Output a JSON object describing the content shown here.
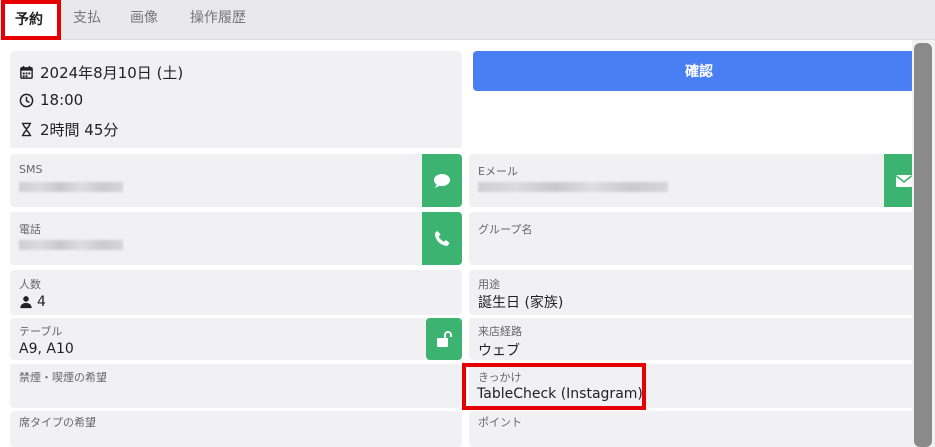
{
  "tabs": [
    {
      "label": "予約",
      "active": true
    },
    {
      "label": "支払"
    },
    {
      "label": "画像"
    },
    {
      "label": "操作履歴"
    }
  ],
  "reservation": {
    "date": "2024年8月10日 (土)",
    "time": "18:00",
    "duration": "2時間 45分"
  },
  "confirm_label": "確認",
  "fields": {
    "sms_label": "SMS",
    "email_label": "Eメール",
    "phone_label": "電話",
    "group_label": "グループ名",
    "people_label": "人数",
    "people_value": "4",
    "purpose_label": "用途",
    "purpose_value": "誕生日 (家族)",
    "table_label": "テーブル",
    "table_value": "A9, A10",
    "source_label": "来店経路",
    "source_value": "ウェブ",
    "smoking_label": "禁煙・喫煙の希望",
    "trigger_label": "きっかけ",
    "trigger_value": "TableCheck (Instagram)",
    "seat_label": "席タイプの希望",
    "points_label": "ポイント"
  },
  "icons": {
    "calendar": "calendar-icon",
    "clock": "clock-icon",
    "hourglass": "hourglass-icon",
    "chat": "chat-icon",
    "mail": "mail-icon",
    "phone": "phone-icon",
    "person": "person-icon",
    "unlock": "unlock-icon"
  },
  "colors": {
    "accent_blue": "#4a7ef3",
    "green": "#3cb371",
    "highlight_red": "#e60000"
  }
}
